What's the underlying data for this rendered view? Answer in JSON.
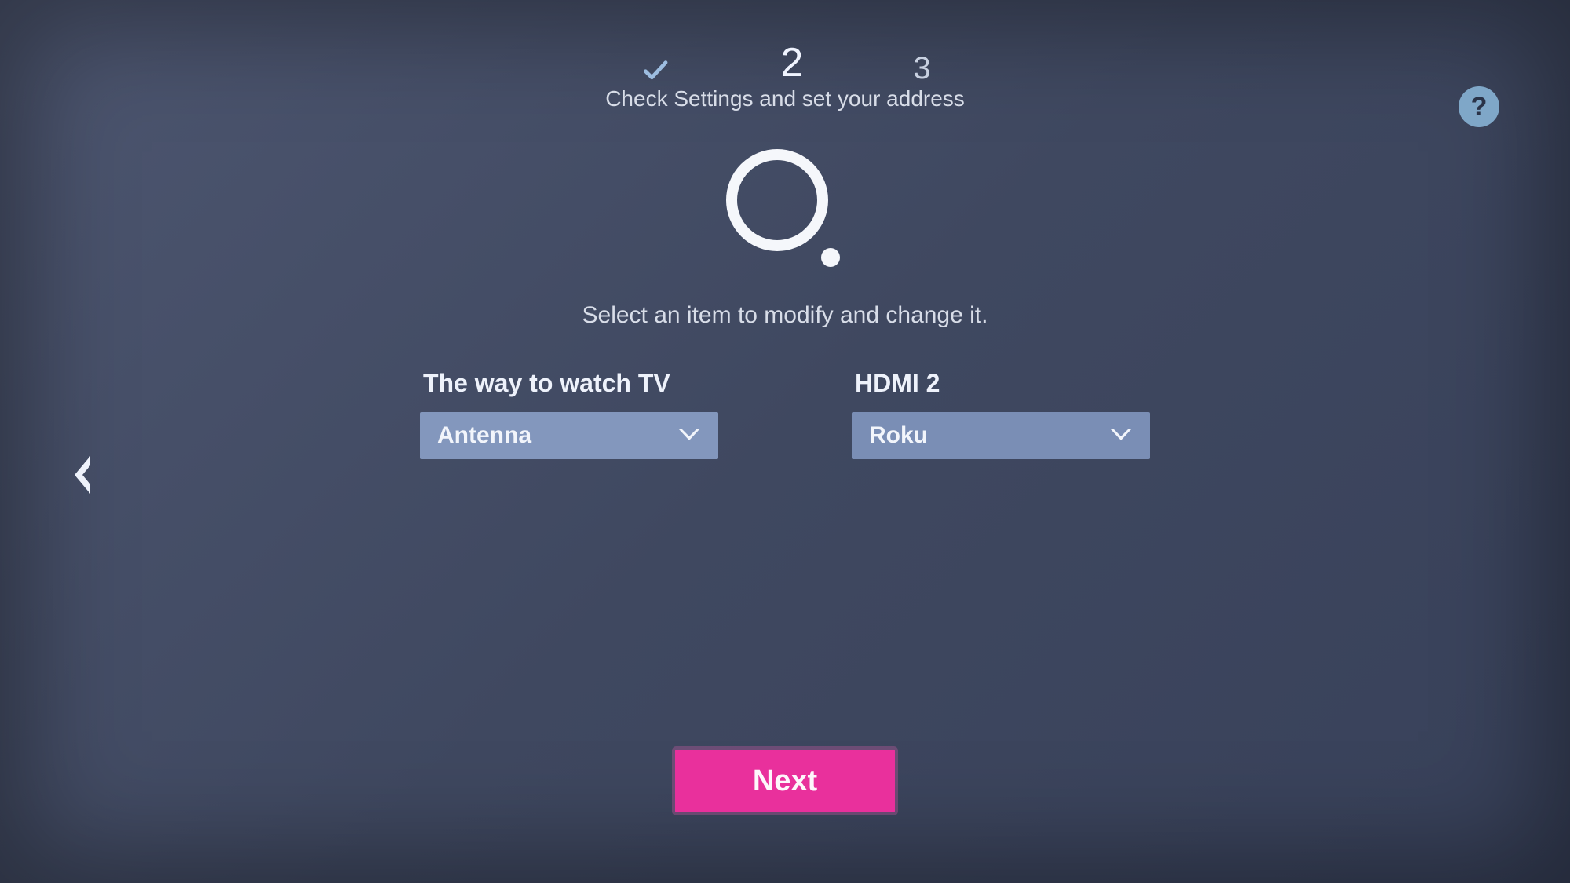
{
  "stepper": {
    "step1_checked": true,
    "step2": "2",
    "step3": "3",
    "subtitle": "Check Settings and set your address"
  },
  "help": {
    "label": "?"
  },
  "instruction": "Select an item to modify and change it.",
  "settings": {
    "watch": {
      "label": "The way to watch TV",
      "value": "Antenna"
    },
    "hdmi": {
      "label": "HDMI 2",
      "value": "Roku"
    }
  },
  "next_button": "Next"
}
